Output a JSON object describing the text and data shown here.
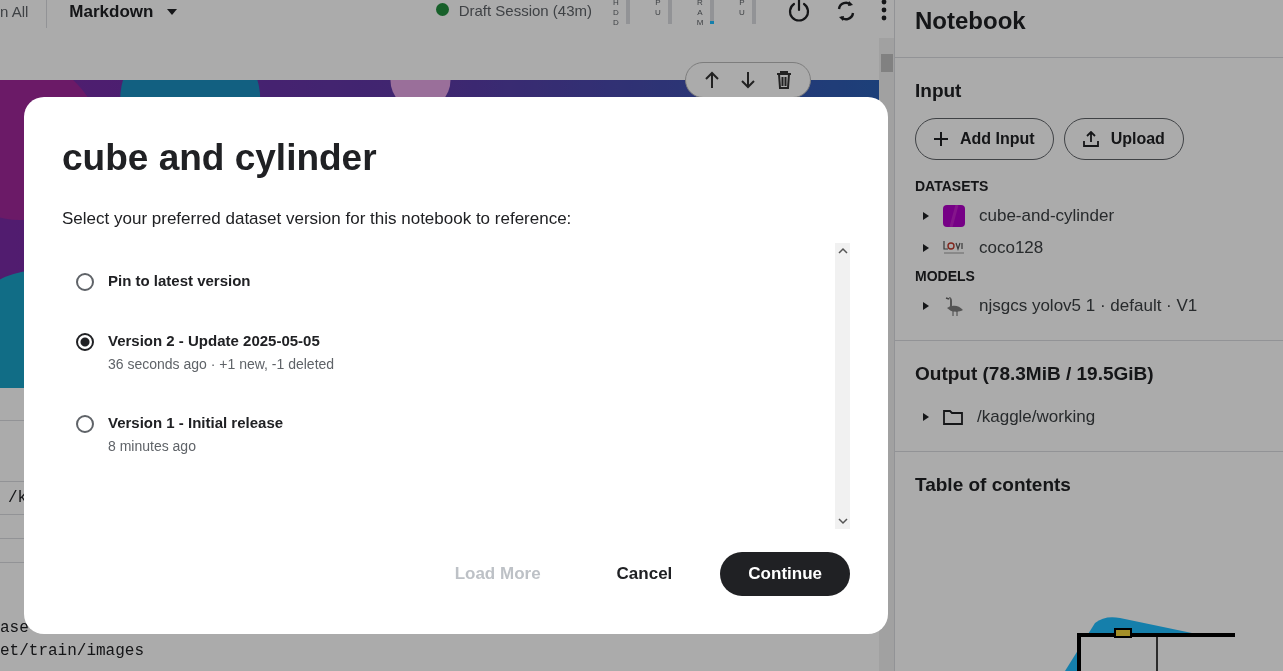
{
  "toolbar": {
    "run_all": "n All",
    "cell_type": "Markdown",
    "session": {
      "label": "Draft Session (43m)",
      "color": "#17602a"
    },
    "meters": [
      {
        "label": "HDD",
        "level": 0.0
      },
      {
        "label": "PU",
        "level": 0.0
      },
      {
        "label": "RAM",
        "level": 0.1
      },
      {
        "label": "PU",
        "level": 0.0
      }
    ]
  },
  "editor": {
    "code_lines": [
      "/k",
      "ase",
      "et/train/images"
    ]
  },
  "sidebar": {
    "title": "Notebook",
    "input": {
      "heading": "Input",
      "buttons": [
        "Add Input",
        "Upload"
      ],
      "sections": [
        {
          "heading": "DATASETS",
          "items": [
            {
              "kind": "dataset",
              "label": "cube-and-cylinder",
              "expanded": false
            },
            {
              "kind": "logo",
              "label": "coco128",
              "expanded": false
            }
          ]
        },
        {
          "heading": "MODELS",
          "items": [
            {
              "kind": "model",
              "label": "njsgcs yolov5 1 · default · V1",
              "expanded": false
            }
          ]
        }
      ]
    },
    "output": {
      "heading": "Output (78.3MiB / 19.5GiB)",
      "items": [
        {
          "label": "/kaggle/working",
          "expanded": false
        }
      ]
    },
    "toc": {
      "heading": "Table of contents"
    }
  },
  "dialog": {
    "title": "cube and cylinder",
    "prompt": "Select your preferred dataset version for this notebook to reference:",
    "options": [
      {
        "label": "Pin to latest version",
        "selected": false
      },
      {
        "label": "Version 2 - Update 2025-05-05",
        "detail": "36 seconds ago · +1 new, -1 deleted",
        "selected": true
      },
      {
        "label": "Version 1 - Initial release",
        "detail": "8 minutes ago",
        "selected": false
      }
    ],
    "buttons": [
      {
        "label": "Load More",
        "kind": "text",
        "disabled": true
      },
      {
        "label": "Cancel",
        "kind": "text",
        "disabled": false
      },
      {
        "label": "Continue",
        "kind": "primary",
        "disabled": false
      }
    ]
  }
}
